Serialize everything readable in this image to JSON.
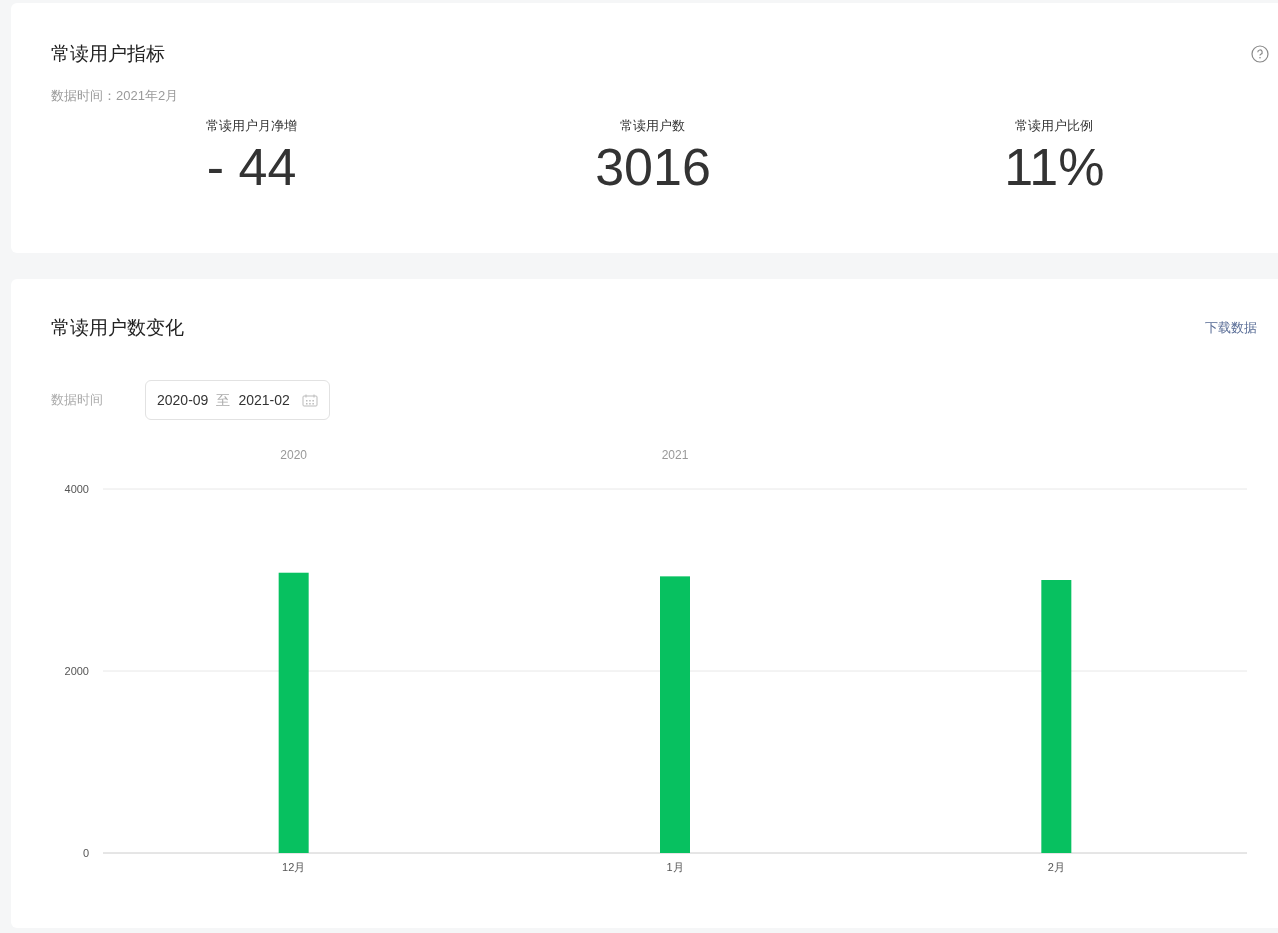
{
  "metrics_card": {
    "title": "常读用户指标",
    "data_time": "数据时间：2021年2月",
    "metrics": [
      {
        "label": "常读用户月净增",
        "value": "- 44"
      },
      {
        "label": "常读用户数",
        "value": "3016"
      },
      {
        "label": "常读用户比例",
        "value": "11%"
      }
    ]
  },
  "trend_card": {
    "title": "常读用户数变化",
    "download_link": "下载数据",
    "date_label": "数据时间",
    "date_range": {
      "start": "2020-09",
      "separator": "至",
      "end": "2021-02"
    },
    "chart_data": {
      "type": "bar",
      "categories": [
        "12月",
        "1月",
        "2月"
      ],
      "series": [
        {
          "color": "#07c160",
          "values": [
            3080,
            3040,
            3000
          ]
        }
      ],
      "ylim": [
        0,
        4000
      ],
      "yticks": [
        0,
        2000,
        4000
      ],
      "annotations": [
        "2020",
        "2021"
      ]
    }
  }
}
